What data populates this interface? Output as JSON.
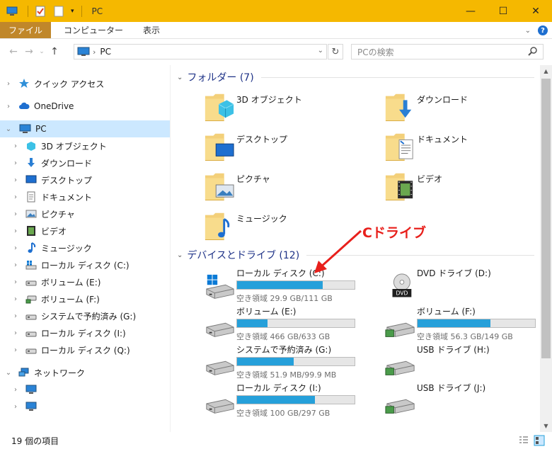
{
  "window": {
    "title": "PC",
    "controls": {
      "minimize": "—",
      "maximize": "☐",
      "close": "✕"
    }
  },
  "ribbon": {
    "tabs": [
      {
        "label": "ファイル",
        "active": true
      },
      {
        "label": "コンピューター",
        "active": false
      },
      {
        "label": "表示",
        "active": false
      }
    ]
  },
  "address": {
    "path": "PC",
    "search_placeholder": "PCの検索"
  },
  "nav": {
    "quick_access": "クイック アクセス",
    "onedrive": "OneDrive",
    "pc": "PC",
    "pc_children": [
      {
        "label": "3D オブジェクト",
        "icon": "cube-icon"
      },
      {
        "label": "ダウンロード",
        "icon": "download-icon"
      },
      {
        "label": "デスクトップ",
        "icon": "desktop-icon"
      },
      {
        "label": "ドキュメント",
        "icon": "document-icon"
      },
      {
        "label": "ピクチャ",
        "icon": "picture-icon"
      },
      {
        "label": "ビデオ",
        "icon": "video-icon"
      },
      {
        "label": "ミュージック",
        "icon": "music-icon"
      },
      {
        "label": "ローカル ディスク (C:)",
        "icon": "windows-drive-icon"
      },
      {
        "label": "ボリューム (E:)",
        "icon": "drive-icon"
      },
      {
        "label": "ボリューム (F:)",
        "icon": "network-drive-icon"
      },
      {
        "label": "システムで予約済み (G:)",
        "icon": "drive-icon"
      },
      {
        "label": "ローカル ディスク (I:)",
        "icon": "drive-icon"
      },
      {
        "label": "ローカル ディスク (Q:)",
        "icon": "drive-icon"
      }
    ],
    "network": "ネットワーク",
    "network_children": [
      "",
      ""
    ]
  },
  "folders": {
    "heading": "フォルダー (7)",
    "items": [
      {
        "label": "3D オブジェクト",
        "overlay": "cube"
      },
      {
        "label": "ダウンロード",
        "overlay": "download"
      },
      {
        "label": "デスクトップ",
        "overlay": "desktop"
      },
      {
        "label": "ドキュメント",
        "overlay": "document"
      },
      {
        "label": "ピクチャ",
        "overlay": "picture"
      },
      {
        "label": "ビデオ",
        "overlay": "video"
      },
      {
        "label": "ミュージック",
        "overlay": "music"
      }
    ]
  },
  "drives": {
    "heading": "デバイスとドライブ (12)",
    "items": [
      {
        "name": "ローカル ディスク (C:)",
        "free": "空き領域 29.9 GB/111 GB",
        "used_fraction": 0.73,
        "icon": "windows-drive"
      },
      {
        "name": "DVD ドライブ (D:)",
        "free": "",
        "used_fraction": null,
        "icon": "dvd"
      },
      {
        "name": "ボリューム (E:)",
        "free": "空き領域 466 GB/633 GB",
        "used_fraction": 0.26,
        "icon": "drive"
      },
      {
        "name": "ボリューム (F:)",
        "free": "空き領域 56.3 GB/149 GB",
        "used_fraction": 0.62,
        "icon": "network-drive"
      },
      {
        "name": "システムで予約済み (G:)",
        "free": "空き領域 51.9 MB/99.9 MB",
        "used_fraction": 0.48,
        "icon": "drive"
      },
      {
        "name": "USB ドライブ (H:)",
        "free": "",
        "used_fraction": null,
        "icon": "usb"
      },
      {
        "name": "ローカル ディスク (I:)",
        "free": "空き領域 100 GB/297 GB",
        "used_fraction": 0.66,
        "icon": "drive"
      },
      {
        "name": "USB ドライブ (J:)",
        "free": "",
        "used_fraction": null,
        "icon": "usb"
      }
    ]
  },
  "annotation": {
    "text": "Cドライブ",
    "color": "#e8201c"
  },
  "status": {
    "items_count": "19 個の項目"
  },
  "colors": {
    "titlebar": "#f5b800",
    "file_tab": "#c0872a",
    "selected": "#cce8ff",
    "bar_fill": "#26a0da",
    "group_heading": "#1e3287"
  }
}
